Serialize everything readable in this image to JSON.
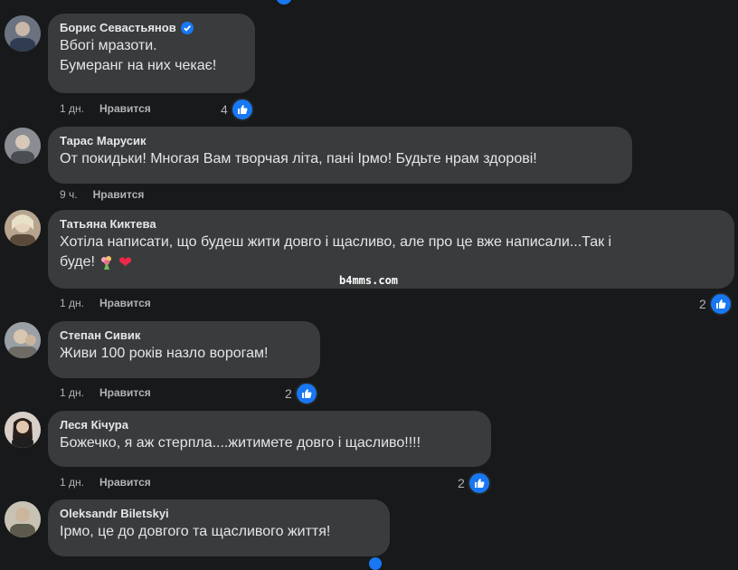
{
  "comments": [
    {
      "author": "Борис Севастьянов",
      "verified": true,
      "lines": [
        "Вбогі мразоти.",
        "Бумеранг на них чекає!"
      ],
      "time": "1 дн.",
      "like_label": "Нравится",
      "reaction_count": "4"
    },
    {
      "author": "Тарас Марусик",
      "verified": false,
      "lines": [
        "От покидьки! Многая Вам творчая літа, пані Ірмо! Будьте нрам здорові!"
      ],
      "time": "9 ч.",
      "like_label": "Нравится",
      "reaction_count": ""
    },
    {
      "author": "Татьяна Киктева",
      "verified": false,
      "lines": [
        "Хотіла написати, що будеш жити довго і щасливо, але про це вже написали...Так і",
        "буде!"
      ],
      "emojis": [
        "flower-bouquet",
        "red-heart"
      ],
      "time": "1 дн.",
      "like_label": "Нравится",
      "reaction_count": "2"
    },
    {
      "author": "Степан Сивик",
      "verified": false,
      "lines": [
        "Живи 100 років назло ворогам!"
      ],
      "time": "1 дн.",
      "like_label": "Нравится",
      "reaction_count": "2"
    },
    {
      "author": "Леся Кічура",
      "verified": false,
      "lines": [
        "Божечко, я аж стерпла....житимете довго і щасливо!!!!"
      ],
      "time": "1 дн.",
      "like_label": "Нравится",
      "reaction_count": "2"
    },
    {
      "author": "Oleksandr Biletskyi",
      "verified": false,
      "lines": [
        "Ірмо, це до довгого та щасливого життя!"
      ],
      "time": "",
      "like_label": "",
      "reaction_count": ""
    }
  ],
  "watermark": "b4mms.com",
  "colors": {
    "background": "#18191a",
    "bubble": "#3a3b3c",
    "like_blue": "#1877f2",
    "heart": "#f02849"
  }
}
